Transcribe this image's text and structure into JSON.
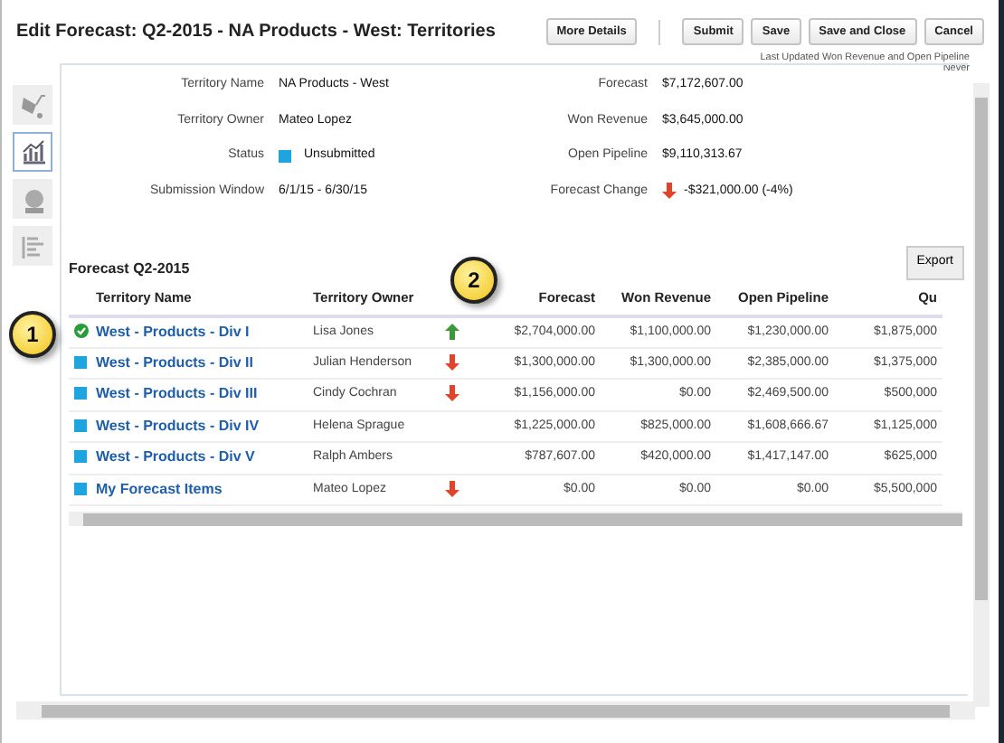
{
  "title": "Edit Forecast: Q2-2015 - NA Products - West: Territories",
  "buttons": [
    {
      "label": "More Details"
    },
    {
      "label": "Submit"
    },
    {
      "label": "Save"
    },
    {
      "label": "Save and Close"
    },
    {
      "label": "Cancel"
    }
  ],
  "last_updated": {
    "label": "Last Updated Won Revenue and Open Pipeline",
    "value": "Never"
  },
  "side_tabs": [
    {
      "kind": "cart",
      "selected": false
    },
    {
      "kind": "chart",
      "selected": true
    },
    {
      "kind": "globe",
      "selected": false
    },
    {
      "kind": "list",
      "selected": false
    }
  ],
  "summary_left": [
    {
      "label": "Territory Name",
      "value": "NA Products - West"
    },
    {
      "label": "Territory Owner",
      "value": "Mateo Lopez"
    },
    {
      "label": "Status",
      "value": "Unsubmitted",
      "submitted": false
    },
    {
      "label": "Submission Window",
      "value": "6/1/15 - 6/30/15"
    }
  ],
  "summary_right": [
    {
      "label": "Forecast",
      "value": "$7,172,607.00"
    },
    {
      "label": "Won Revenue",
      "value": "$3,645,000.00"
    },
    {
      "label": "Open Pipeline",
      "value": "$9,110,313.67"
    },
    {
      "label": "Forecast Change",
      "value": "-$321,000.00 (-4%)",
      "down": true
    }
  ],
  "section_title": "Forecast Q2-2015",
  "export_button": "Export",
  "table": {
    "columns": [
      "Territory Name",
      "Territory Owner",
      "Forecast",
      "Won Revenue",
      "Open Pipeline",
      "Qu"
    ],
    "rows": [
      {
        "submitted": true,
        "name": "West - Products - Div I",
        "owner": "Lisa Jones",
        "up": true,
        "down": false,
        "forecast": "$2,704,000.00",
        "won": "$1,100,000.00",
        "pipeline": "$1,230,000.00",
        "column_6": "$1,875,000"
      },
      {
        "submitted": false,
        "name": "West - Products - Div II",
        "owner": "Julian Henderson",
        "up": false,
        "down": true,
        "forecast": "$1,300,000.00",
        "won": "$1,300,000.00",
        "pipeline": "$2,385,000.00",
        "column_6": "$1,375,000"
      },
      {
        "submitted": false,
        "name": "West - Products - Div III",
        "owner": "Cindy Cochran",
        "up": false,
        "down": true,
        "forecast": "$1,156,000.00",
        "won": "$0.00",
        "pipeline": "$2,469,500.00",
        "column_6": "$500,000"
      },
      {
        "submitted": false,
        "name": "West - Products - Div IV",
        "owner": "Helena Sprague",
        "up": false,
        "down": false,
        "forecast": "$1,225,000.00",
        "won": "$825,000.00",
        "pipeline": "$1,608,666.67",
        "column_6": "$1,125,000"
      },
      {
        "submitted": false,
        "name": "West - Products - Div V",
        "owner": "Ralph Ambers",
        "up": false,
        "down": false,
        "forecast": "$787,607.00",
        "won": "$420,000.00",
        "pipeline": "$1,417,147.00",
        "column_6": "$625,000"
      },
      {
        "submitted": false,
        "name": "My Forecast Items",
        "owner": "Mateo Lopez",
        "up": false,
        "down": true,
        "forecast": "$0.00",
        "won": "$0.00",
        "pipeline": "$0.00",
        "column_6": "$5,500,000"
      }
    ]
  },
  "callouts": [
    "1",
    "2"
  ]
}
